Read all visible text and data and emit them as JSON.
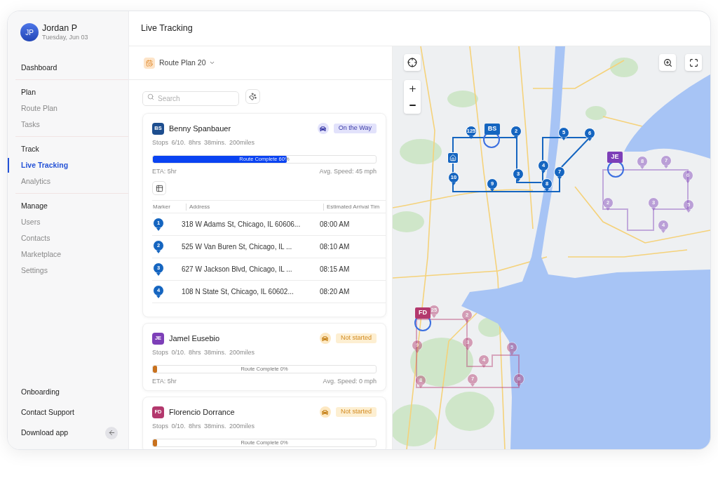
{
  "user": {
    "initials": "JP",
    "name": "Jordan P",
    "date": "Tuesday, Jun 03"
  },
  "nav": [
    {
      "kind": "link",
      "label": "Dashboard",
      "selected": false
    },
    {
      "kind": "group",
      "title": "Plan",
      "items": [
        {
          "label": "Route Plan",
          "selected": false
        },
        {
          "label": "Tasks",
          "selected": false
        }
      ]
    },
    {
      "kind": "group",
      "title": "Track",
      "items": [
        {
          "label": "Live Tracking",
          "selected": true
        },
        {
          "label": "Analytics",
          "selected": false
        }
      ]
    },
    {
      "kind": "group",
      "title": "Manage",
      "items": [
        {
          "label": "Users",
          "selected": false
        },
        {
          "label": "Contacts",
          "selected": false
        },
        {
          "label": "Marketplace",
          "selected": false
        },
        {
          "label": "Settings",
          "selected": false
        }
      ]
    }
  ],
  "nav_footer": [
    {
      "label": "Onboarding"
    },
    {
      "label": "Contact Support"
    },
    {
      "label": "Download app"
    }
  ],
  "header": {
    "title": "Live Tracking"
  },
  "route_plan": {
    "label": "Route Plan 20"
  },
  "search": {
    "placeholder": "Search"
  },
  "drivers": [
    {
      "initials": "BS",
      "name": "Benny Spanbauer",
      "color": "#1d4e8f",
      "status": {
        "kind": "on_the_way",
        "label": "On the Way"
      },
      "stats": "Stops 6/10. 8hrs 38mins. 200miles",
      "progress": {
        "level": 0.6,
        "label": "Route Complete 60%"
      },
      "eta": "ETA: 5hr",
      "speed": "Avg. Speed: 45 mph",
      "stops_table": {
        "columns": [
          "Marker",
          "Address",
          "Estimated Arrival Tim"
        ],
        "rows": [
          {
            "marker": "1",
            "address": "318 W Adams St, Chicago, IL 60606...",
            "time": "08:00 AM"
          },
          {
            "marker": "2",
            "address": "525 W Van Buren St, Chicago, IL ...",
            "time": "08:10 AM"
          },
          {
            "marker": "3",
            "address": "627 W Jackson Blvd, Chicago, IL ...",
            "time": "08:15 AM"
          },
          {
            "marker": "4",
            "address": "108 N State St, Chicago, IL 60602...",
            "time": "08:20 AM"
          }
        ]
      }
    },
    {
      "initials": "JE",
      "name": "Jamel Eusebio",
      "color": "#7d3fb8",
      "status": {
        "kind": "not_started",
        "label": "Not started"
      },
      "stats": "Stops 0/10. 8hrs 38mins. 200miles",
      "progress": {
        "level": 0,
        "label": "Route Complete 0%"
      },
      "eta": "ETA: 5hr",
      "speed": "Avg. Speed: 0 mph"
    },
    {
      "initials": "FD",
      "name": "Florencio Dorrance",
      "color": "#b3386d",
      "status": {
        "kind": "not_started",
        "label": "Not started"
      },
      "stats": "Stops 0/10. 8hrs 38mins. 200miles",
      "progress": {
        "level": 0,
        "label": "Route Complete 0%"
      }
    }
  ],
  "map": {
    "routes": [
      {
        "driver": "BS",
        "color": "#1565c0",
        "selected": true,
        "stops": [
          "125",
          "2",
          "5",
          "6",
          "4",
          "10",
          "3",
          "7",
          "9",
          "8"
        ]
      },
      {
        "driver": "JE",
        "color": "#7d3fb8",
        "selected": false,
        "stops": [
          "8",
          "7",
          "6",
          "2",
          "3",
          "5",
          "4"
        ]
      },
      {
        "driver": "FD",
        "color": "#b3386d",
        "selected": false,
        "stops": [
          "25",
          "2",
          "9",
          "3",
          "5",
          "4",
          "8",
          "7",
          "6"
        ]
      }
    ]
  }
}
